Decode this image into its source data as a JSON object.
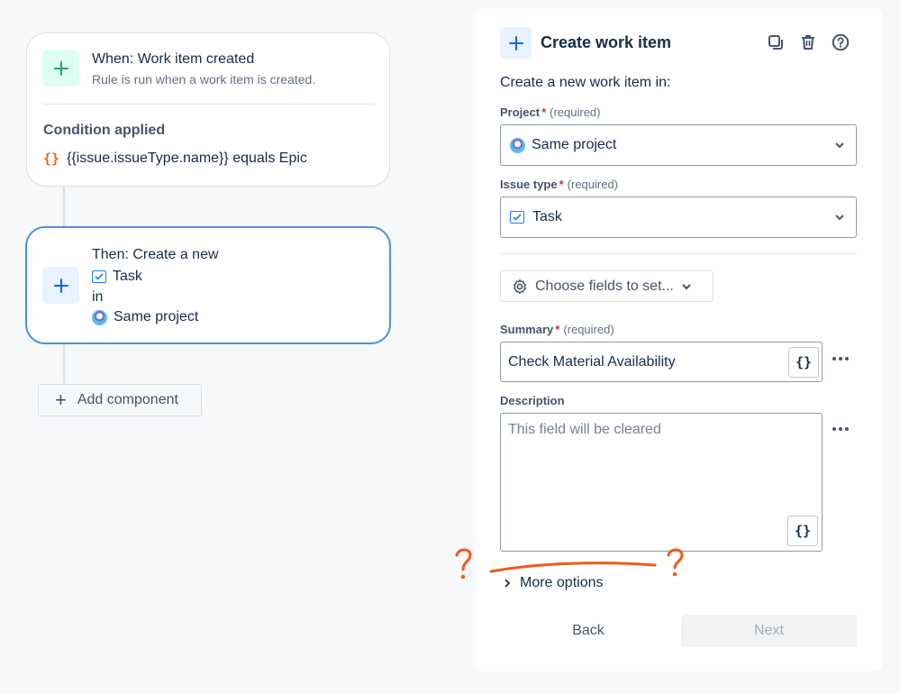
{
  "trigger": {
    "title": "When: Work item created",
    "subtitle": "Rule is run when a work item is created.",
    "condition_title": "Condition applied",
    "condition_braces": "{}",
    "condition_text": "{{issue.issueType.name}} equals Epic"
  },
  "action": {
    "line1": "Then: Create a new",
    "issue_type": "Task",
    "line3": "in",
    "project": "Same project"
  },
  "add_component_label": "Add component",
  "panel": {
    "title": "Create work item",
    "intro": "Create a new work item in:",
    "project_label": "Project",
    "project_required": "*",
    "project_required_note": "(required)",
    "project_value": "Same project",
    "issue_type_label": "Issue type",
    "issue_type_required": "*",
    "issue_type_required_note": "(required)",
    "issue_type_value": "Task",
    "choose_fields_label": "Choose fields to set...",
    "summary_label": "Summary",
    "summary_required": "*",
    "summary_required_note": "(required)",
    "summary_value": "Check Material Availability",
    "smart_value_label": "{}",
    "description_label": "Description",
    "description_placeholder": "This field will be cleared",
    "more_options_label": "More options",
    "back_label": "Back",
    "next_label": "Next"
  },
  "icons": {
    "trigger": "plus-icon",
    "action": "plus-icon",
    "header": "plus-icon",
    "duplicate": "duplicate-icon",
    "delete": "trash-icon",
    "help": "help-icon",
    "settings": "gear-icon",
    "chevron": "chevron-down-icon",
    "more": "ellipsis-icon",
    "expand": "chevron-right-icon"
  },
  "colors": {
    "accent": "#0c66e4",
    "trigger_icon_bg": "#dcfff1",
    "trigger_icon": "#22a06b",
    "action_border": "#4c8fe6",
    "required": "#c9372c",
    "condition_braces": "#e56910",
    "annotation": "#f05a1a"
  }
}
